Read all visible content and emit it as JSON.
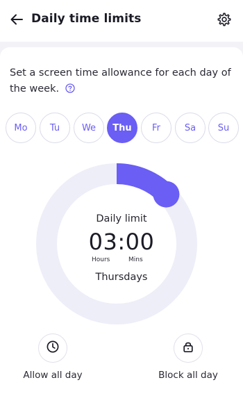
{
  "header": {
    "title": "Daily time limits",
    "back_icon": "arrow-left-icon",
    "settings_icon": "gear-icon"
  },
  "description": "Set a screen time allowance for each day of the week.",
  "help_icon": "help-circle-icon",
  "days": [
    {
      "label": "Mo",
      "selected": false
    },
    {
      "label": "Tu",
      "selected": false
    },
    {
      "label": "We",
      "selected": false
    },
    {
      "label": "Thu",
      "selected": true
    },
    {
      "label": "Fr",
      "selected": false
    },
    {
      "label": "Sa",
      "selected": false
    },
    {
      "label": "Su",
      "selected": false
    }
  ],
  "dial": {
    "title": "Daily limit",
    "time": "03:00",
    "hours_label": "Hours",
    "mins_label": "Mins",
    "day_label": "Thursdays",
    "fraction_of_day": 0.125
  },
  "actions": {
    "allow": {
      "label": "Allow all day",
      "icon": "clock-icon"
    },
    "block": {
      "label": "Block all day",
      "icon": "lock-icon"
    }
  },
  "colors": {
    "accent": "#6a5ef5",
    "track": "#eeeef9"
  }
}
